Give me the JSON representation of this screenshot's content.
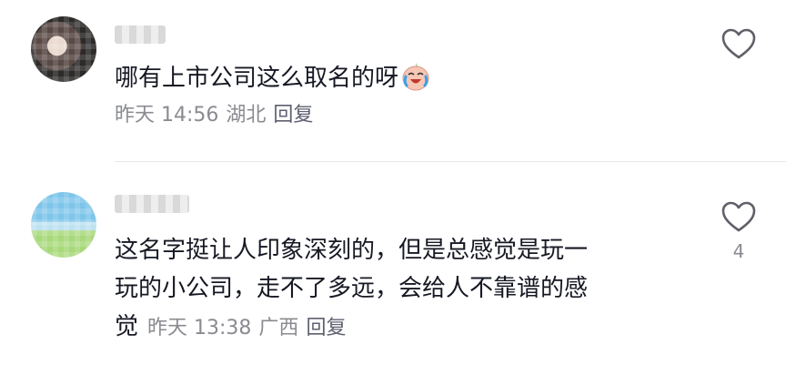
{
  "comments": [
    {
      "text": "哪有上市公司这么取名的呀",
      "emoji": "crying-laughing-face-icon",
      "time": "昨天 14:56",
      "location": "湖北",
      "reply": "回复",
      "like_count": ""
    },
    {
      "lines": [
        "这名字挺让人印象深刻的，但是总感觉是玩一",
        "玩的小公司，走不了多远，会给人不靠谱的感"
      ],
      "last_line": "觉",
      "time": "昨天 13:38",
      "location": "广西",
      "reply": "回复",
      "like_count": "4"
    }
  ],
  "colors": {
    "text": "#161823",
    "meta": "#8a8b91",
    "divider": "#e8e8ec"
  }
}
